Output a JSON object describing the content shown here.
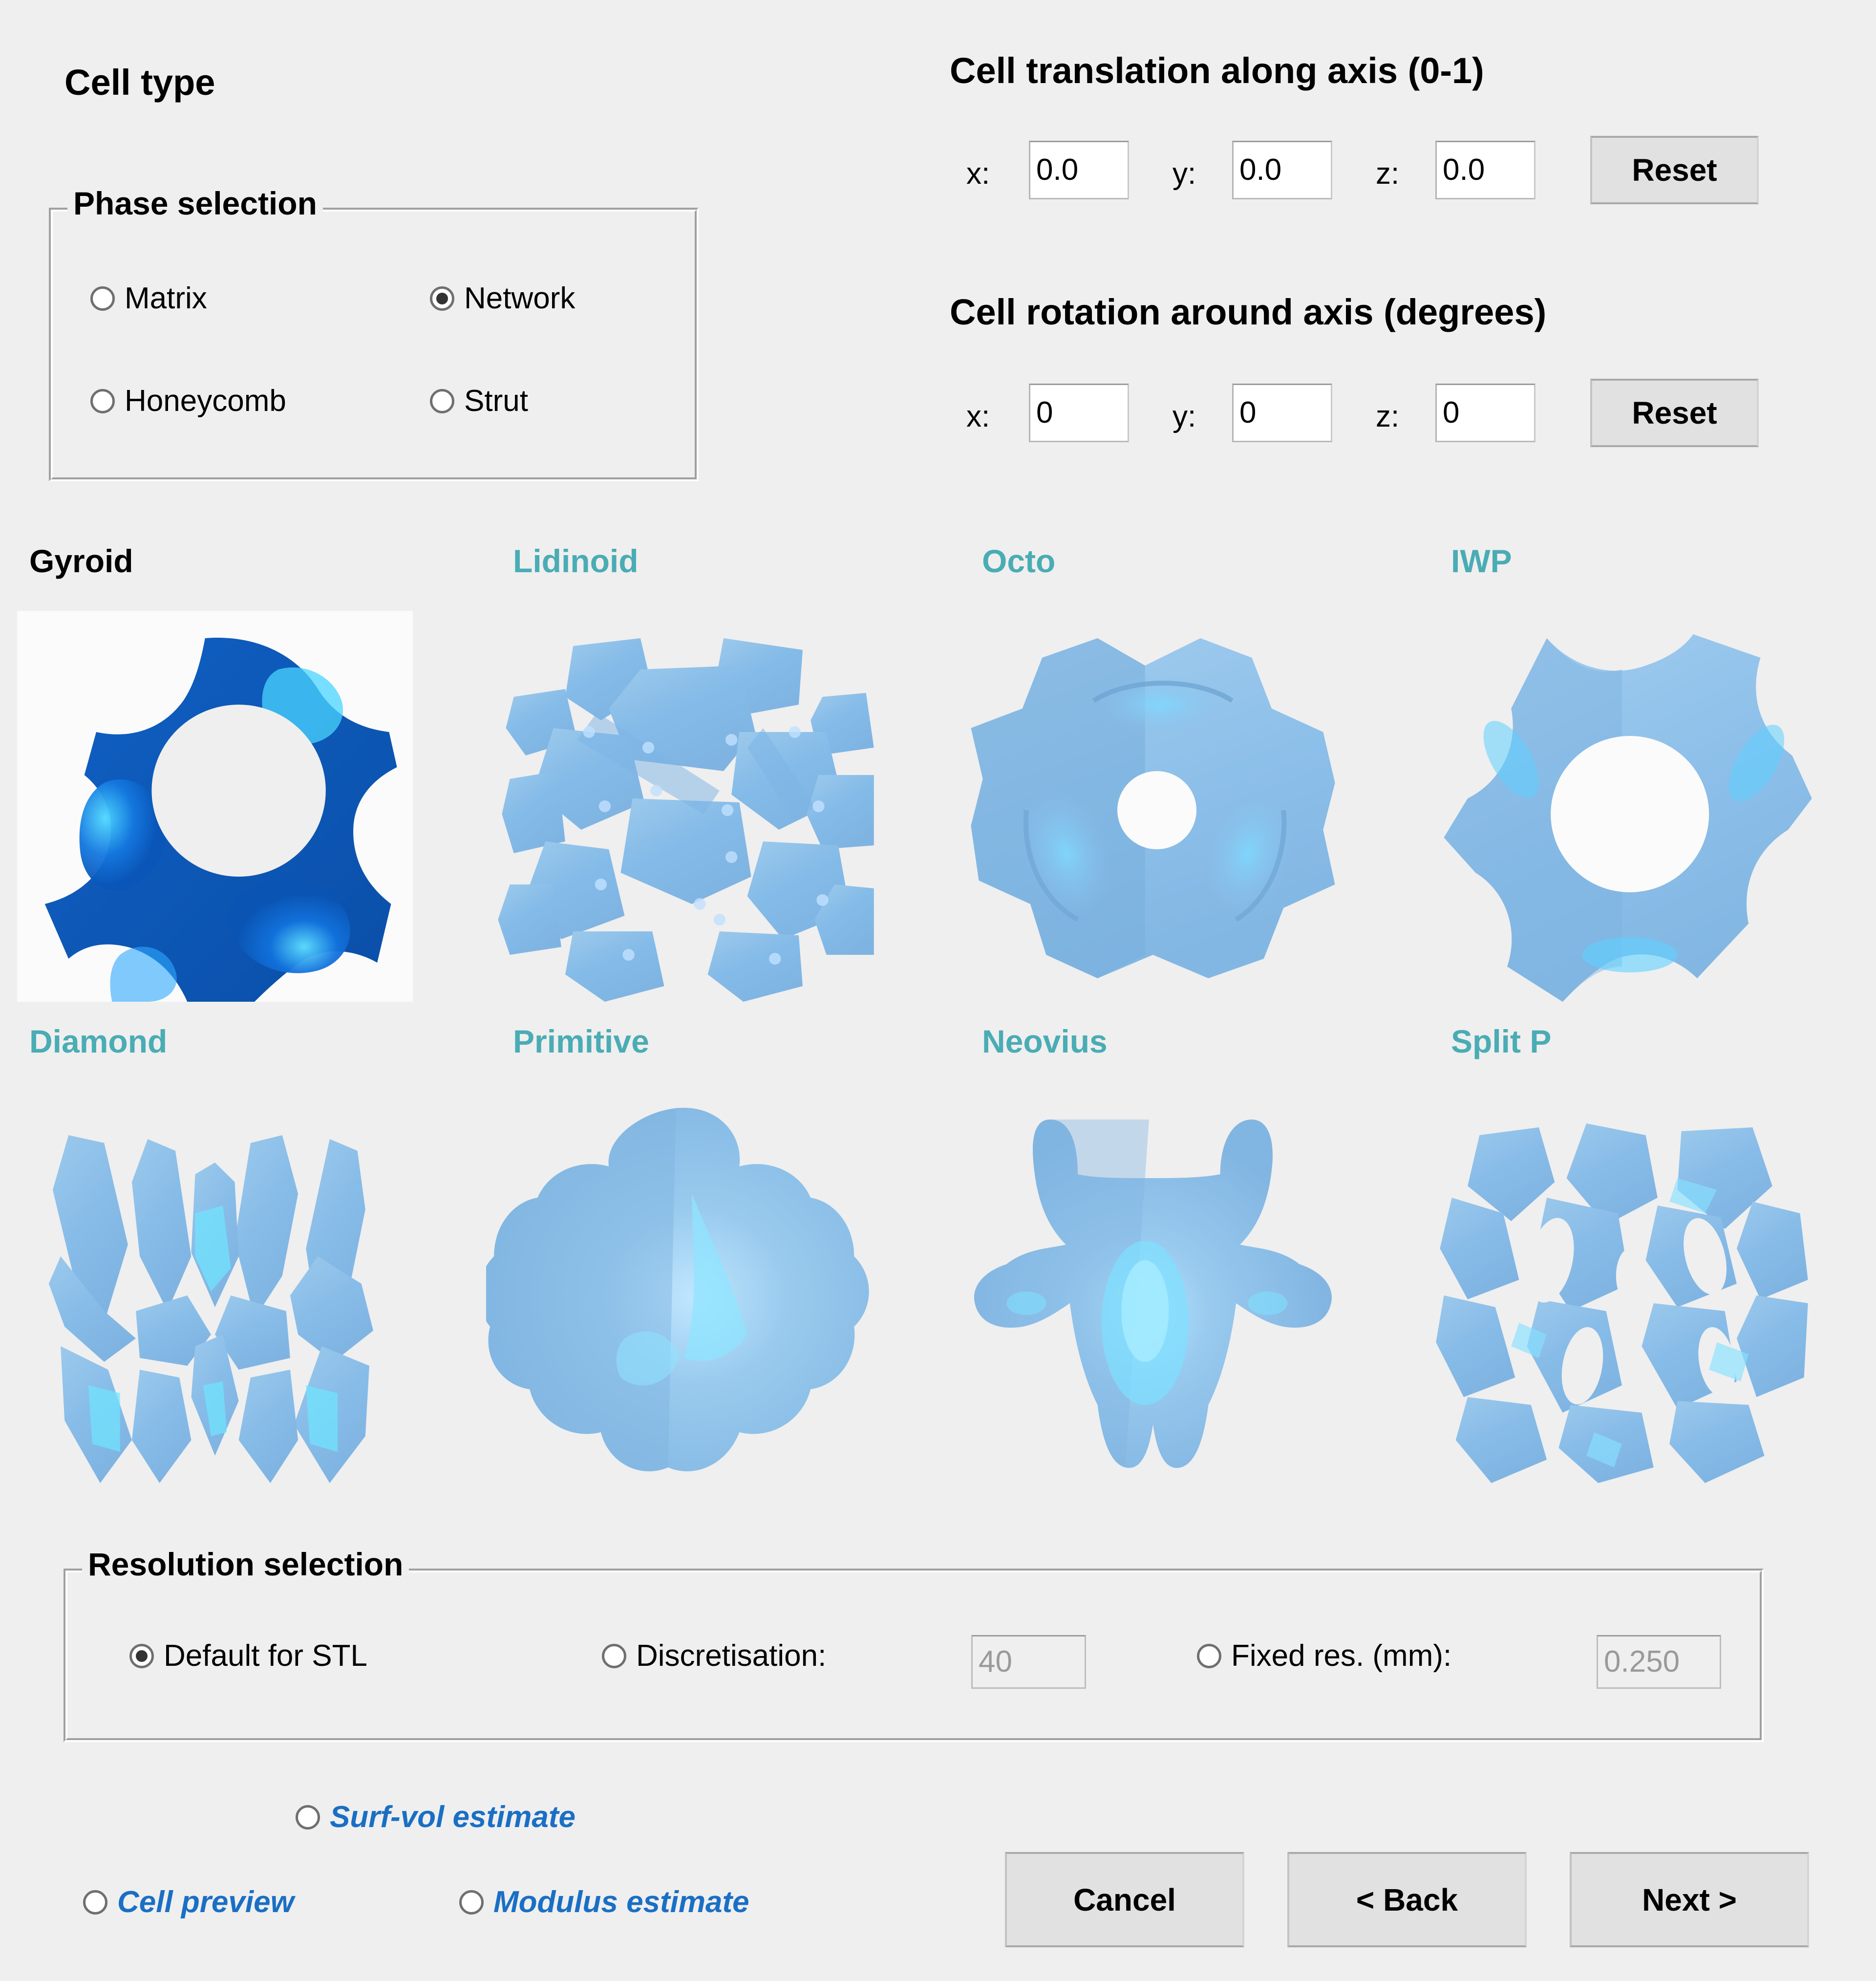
{
  "page": {
    "background": "#efefef",
    "accent_teal": "#4aacb4",
    "accent_blue_link": "#1a6fc4",
    "selected_surface_blue": "#0b62c9",
    "unselected_surface_blue": "#8ebde4"
  },
  "cell_type": {
    "heading": "Cell type",
    "phase_group": {
      "title": "Phase selection",
      "options": [
        {
          "label": "Matrix",
          "checked": false
        },
        {
          "label": "Network",
          "checked": true
        },
        {
          "label": "Honeycomb",
          "checked": false
        },
        {
          "label": "Strut",
          "checked": false
        }
      ]
    }
  },
  "translation": {
    "heading": "Cell translation along axis (0-1)",
    "fields": [
      {
        "axis": "x:",
        "value": "0.0"
      },
      {
        "axis": "y:",
        "value": "0.0"
      },
      {
        "axis": "z:",
        "value": "0.0"
      }
    ],
    "reset_label": "Reset"
  },
  "rotation": {
    "heading": "Cell rotation around axis (degrees)",
    "fields": [
      {
        "axis": "x:",
        "value": "0"
      },
      {
        "axis": "y:",
        "value": "0"
      },
      {
        "axis": "z:",
        "value": "0"
      }
    ],
    "reset_label": "Reset"
  },
  "cell_tiles": [
    {
      "label": "Gyroid",
      "selected": true,
      "icon": "gyroid-thumbnail"
    },
    {
      "label": "Lidinoid",
      "selected": false,
      "icon": "lidinoid-thumbnail"
    },
    {
      "label": "Octo",
      "selected": false,
      "icon": "octo-thumbnail"
    },
    {
      "label": "IWP",
      "selected": false,
      "icon": "iwp-thumbnail"
    },
    {
      "label": "Diamond",
      "selected": false,
      "icon": "diamond-thumbnail"
    },
    {
      "label": "Primitive",
      "selected": false,
      "icon": "primitive-thumbnail"
    },
    {
      "label": "Neovius",
      "selected": false,
      "icon": "neovius-thumbnail"
    },
    {
      "label": "Split P",
      "selected": false,
      "icon": "split-p-thumbnail"
    }
  ],
  "resolution": {
    "title": "Resolution selection",
    "options": [
      {
        "label": "Default for STL",
        "checked": true
      },
      {
        "label": "Discretisation:",
        "checked": false,
        "value": "40",
        "disabled": true
      },
      {
        "label": "Fixed res. (mm):",
        "checked": false,
        "value": "0.250",
        "disabled": true
      }
    ]
  },
  "estimates": [
    {
      "label": "Surf-vol estimate",
      "checked": false
    },
    {
      "label": "Cell preview",
      "checked": false
    },
    {
      "label": "Modulus estimate",
      "checked": false
    }
  ],
  "footer_buttons": [
    {
      "label": "Cancel"
    },
    {
      "label": "< Back"
    },
    {
      "label": "Next >"
    }
  ]
}
